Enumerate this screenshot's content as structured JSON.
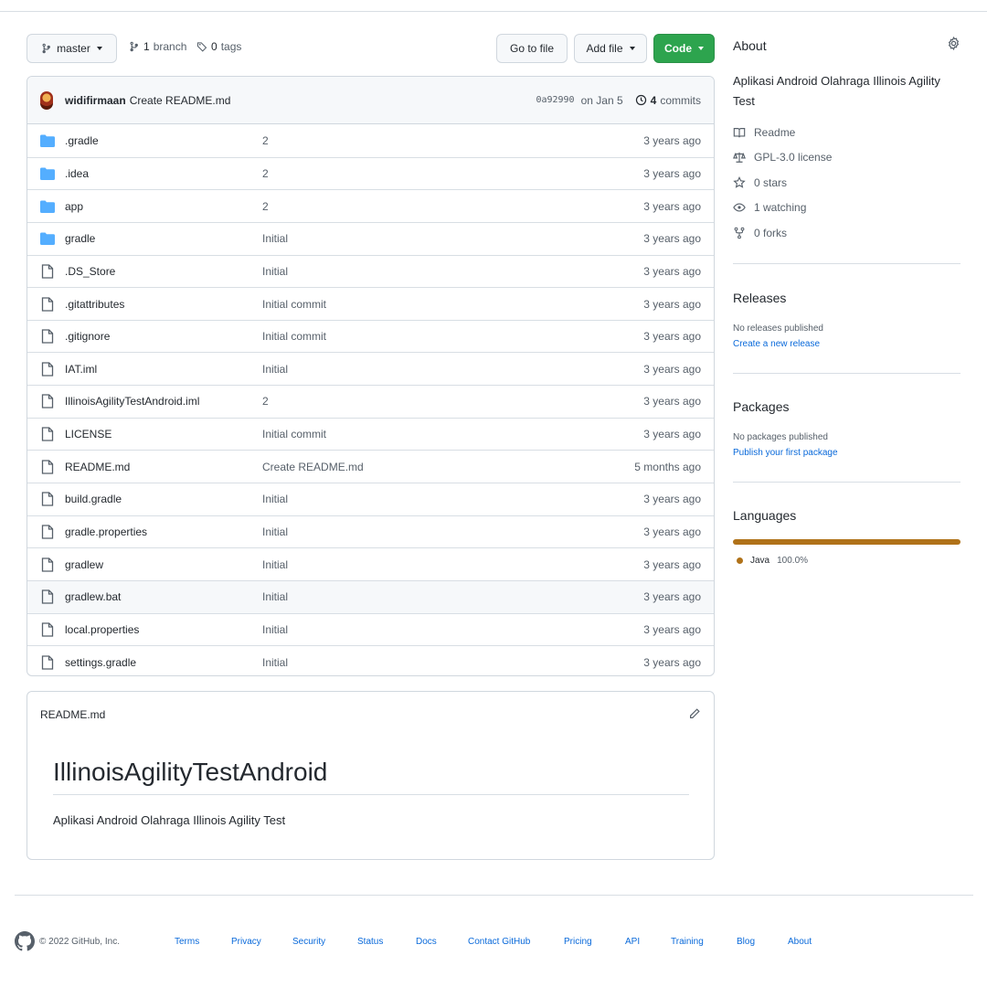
{
  "toolbar": {
    "branch_label": "master",
    "branches_count": "1",
    "branches_label": "branch",
    "tags_count": "0",
    "tags_label": "tags",
    "goto_file_label": "Go to file",
    "add_file_label": "Add file",
    "code_label": "Code"
  },
  "commit": {
    "author": "widifirmaan",
    "message": "Create README.md",
    "sha": "0a92990",
    "date": "on Jan 5",
    "commits_count": "4",
    "commits_label": "commits"
  },
  "files": [
    {
      "type": "dir",
      "name": ".gradle",
      "message": "2",
      "age": "3 years ago"
    },
    {
      "type": "dir",
      "name": ".idea",
      "message": "2",
      "age": "3 years ago"
    },
    {
      "type": "dir",
      "name": "app",
      "message": "2",
      "age": "3 years ago"
    },
    {
      "type": "dir",
      "name": "gradle",
      "message": "Initial",
      "age": "3 years ago"
    },
    {
      "type": "file",
      "name": ".DS_Store",
      "message": "Initial",
      "age": "3 years ago"
    },
    {
      "type": "file",
      "name": ".gitattributes",
      "message": "Initial commit",
      "age": "3 years ago"
    },
    {
      "type": "file",
      "name": ".gitignore",
      "message": "Initial commit",
      "age": "3 years ago"
    },
    {
      "type": "file",
      "name": "IAT.iml",
      "message": "Initial",
      "age": "3 years ago"
    },
    {
      "type": "file",
      "name": "IllinoisAgilityTestAndroid.iml",
      "message": "2",
      "age": "3 years ago"
    },
    {
      "type": "file",
      "name": "LICENSE",
      "message": "Initial commit",
      "age": "3 years ago"
    },
    {
      "type": "file",
      "name": "README.md",
      "message": "Create README.md",
      "age": "5 months ago"
    },
    {
      "type": "file",
      "name": "build.gradle",
      "message": "Initial",
      "age": "3 years ago"
    },
    {
      "type": "file",
      "name": "gradle.properties",
      "message": "Initial",
      "age": "3 years ago"
    },
    {
      "type": "file",
      "name": "gradlew",
      "message": "Initial",
      "age": "3 years ago"
    },
    {
      "type": "file",
      "name": "gradlew.bat",
      "message": "Initial",
      "age": "3 years ago",
      "highlighted": true
    },
    {
      "type": "file",
      "name": "local.properties",
      "message": "Initial",
      "age": "3 years ago"
    },
    {
      "type": "file",
      "name": "settings.gradle",
      "message": "Initial",
      "age": "3 years ago"
    }
  ],
  "readme": {
    "filename": "README.md",
    "heading": "IllinoisAgilityTestAndroid",
    "body": "Aplikasi Android Olahraga Illinois Agility Test"
  },
  "about": {
    "title": "About",
    "description_line1": "Aplikasi Android Olahraga Illinois Agility",
    "description_line2": "Test",
    "meta": [
      {
        "icon": "book-icon",
        "label": "Readme"
      },
      {
        "icon": "scale-icon",
        "label": "GPL-3.0 license"
      },
      {
        "icon": "star-icon",
        "label": "0 stars"
      },
      {
        "icon": "eye-icon",
        "label": "1 watching"
      },
      {
        "icon": "fork-icon",
        "label": "0 forks"
      }
    ]
  },
  "releases": {
    "title": "Releases",
    "empty": "No releases published",
    "link": "Create a new release"
  },
  "packages": {
    "title": "Packages",
    "empty": "No packages published",
    "link": "Publish your first package"
  },
  "languages": {
    "title": "Languages",
    "items": [
      {
        "name": "Java",
        "percent": "100.0%",
        "color": "#b07219",
        "share": 1.0
      }
    ]
  },
  "footer": {
    "copyright": "© 2022 GitHub, Inc.",
    "links": [
      "Terms",
      "Privacy",
      "Security",
      "Status",
      "Docs",
      "Contact GitHub",
      "Pricing",
      "API",
      "Training",
      "Blog",
      "About"
    ]
  },
  "colors": {
    "accent": "#0969da",
    "code_button": "#2da44e",
    "folder": "#54aeff",
    "java": "#b07219"
  }
}
